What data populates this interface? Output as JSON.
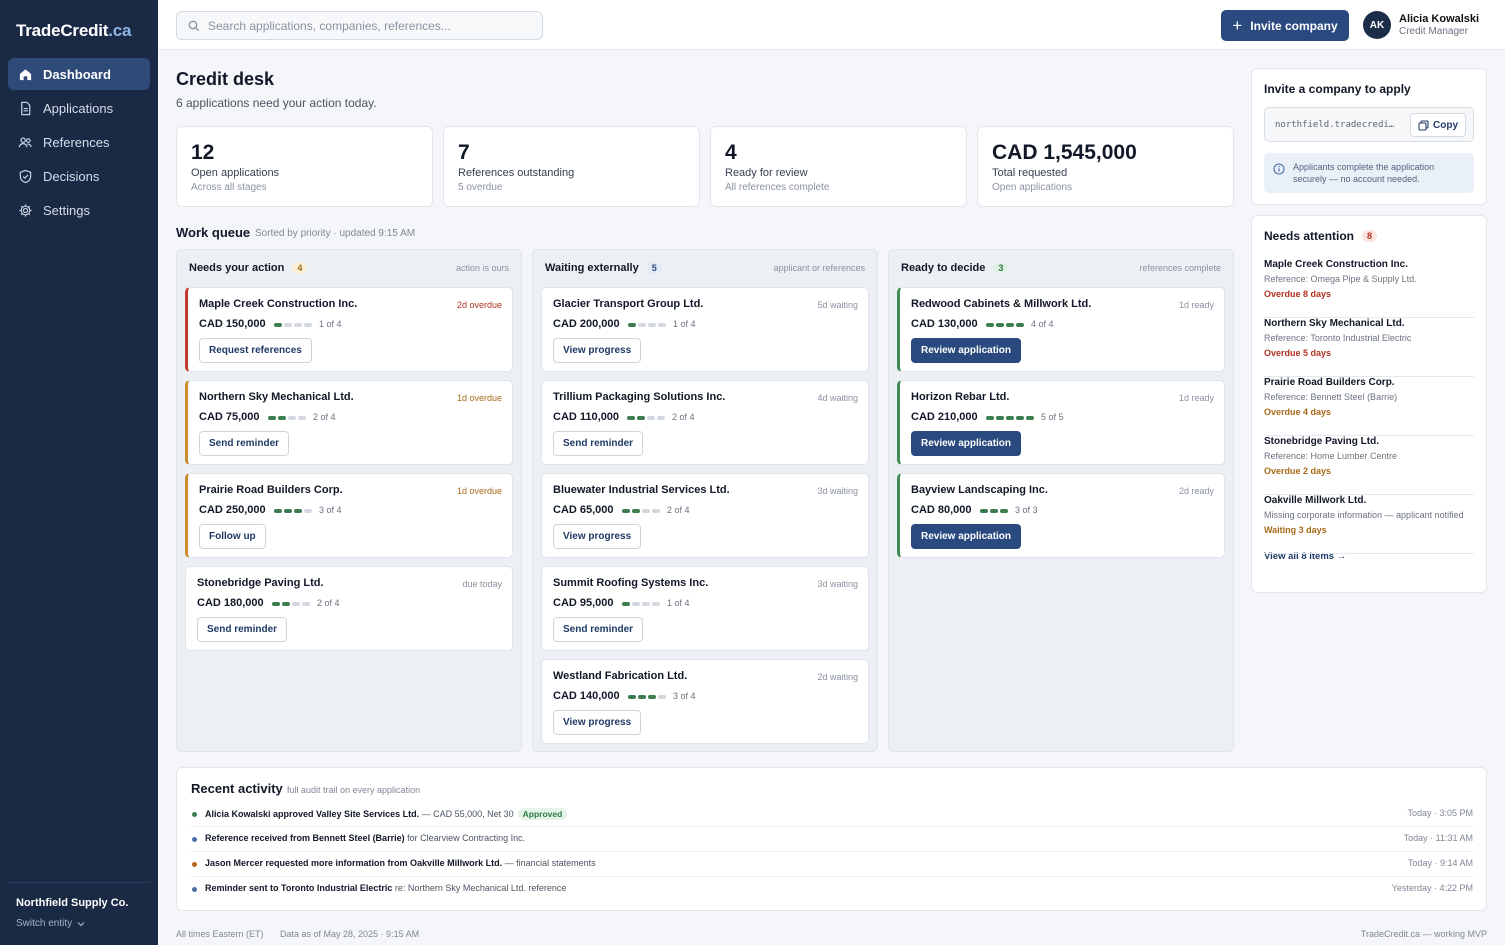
{
  "brand": {
    "name": "TradeCredit",
    "tld": ".ca"
  },
  "sidebar": {
    "items": [
      {
        "label": "Dashboard",
        "icon": "home-icon",
        "active": true
      },
      {
        "label": "Applications",
        "icon": "document-icon"
      },
      {
        "label": "References",
        "icon": "users-icon"
      },
      {
        "label": "Decisions",
        "icon": "shield-check-icon"
      },
      {
        "label": "Settings",
        "icon": "gear-icon"
      }
    ],
    "entity": "Northfield Supply Co.",
    "switch_label": "Switch entity"
  },
  "topbar": {
    "search_placeholder": "Search applications, companies, references...",
    "invite_label": "Invite company",
    "user": {
      "initials": "AK",
      "name": "Alicia Kowalski",
      "role": "Credit Manager"
    }
  },
  "header": {
    "title": "Credit desk",
    "subtitle": "6 applications need your action today."
  },
  "stats": [
    {
      "value": "12",
      "label": "Open applications",
      "sub": "Across all stages"
    },
    {
      "value": "7",
      "label": "References outstanding",
      "sub": "5 overdue"
    },
    {
      "value": "4",
      "label": "Ready for review",
      "sub": "All references complete"
    },
    {
      "value": "CAD 1,545,000",
      "label": "Total requested",
      "sub": "Open applications"
    }
  ],
  "queue": {
    "title": "Work queue",
    "meta": "Sorted by priority · updated 9:15 AM",
    "columns": [
      {
        "title": "Needs your action",
        "count": "4",
        "meta": "action is ours",
        "cards": [
          {
            "name": "Maple Creek Construction Inc.",
            "status": "2d overdue",
            "amount": "CAD 150,000",
            "progress": "1 of 4",
            "done": 1,
            "total": 4,
            "action": "Request references"
          },
          {
            "name": "Northern Sky Mechanical Ltd.",
            "status": "1d overdue",
            "amount": "CAD 75,000",
            "progress": "2 of 4",
            "done": 2,
            "total": 4,
            "action": "Send reminder"
          },
          {
            "name": "Prairie Road Builders Corp.",
            "status": "1d overdue",
            "amount": "CAD 250,000",
            "progress": "3 of 4",
            "done": 3,
            "total": 4,
            "action": "Follow up"
          },
          {
            "name": "Stonebridge Paving Ltd.",
            "status": "due today",
            "amount": "CAD 180,000",
            "progress": "2 of 4",
            "done": 2,
            "total": 4,
            "action": "Send reminder"
          }
        ]
      },
      {
        "title": "Waiting externally",
        "count": "5",
        "meta": "applicant or references",
        "cards": [
          {
            "name": "Glacier Transport Group Ltd.",
            "status": "5d waiting",
            "amount": "CAD 200,000",
            "progress": "1 of 4",
            "done": 1,
            "total": 4,
            "action": "View progress"
          },
          {
            "name": "Trillium Packaging Solutions Inc.",
            "status": "4d waiting",
            "amount": "CAD 110,000",
            "progress": "2 of 4",
            "done": 2,
            "total": 4,
            "action": "Send reminder"
          },
          {
            "name": "Bluewater Industrial Services Ltd.",
            "status": "3d waiting",
            "amount": "CAD 65,000",
            "progress": "2 of 4",
            "done": 2,
            "total": 4,
            "action": "View progress"
          },
          {
            "name": "Summit Roofing Systems Inc.",
            "status": "3d waiting",
            "amount": "CAD 95,000",
            "progress": "1 of 4",
            "done": 1,
            "total": 4,
            "action": "Send reminder"
          },
          {
            "name": "Westland Fabrication Ltd.",
            "status": "2d waiting",
            "amount": "CAD 140,000",
            "progress": "3 of 4",
            "done": 3,
            "total": 4,
            "action": "View progress"
          }
        ]
      },
      {
        "title": "Ready to decide",
        "count": "3",
        "meta": "references complete",
        "cards": [
          {
            "name": "Redwood Cabinets & Millwork Ltd.",
            "status": "1d ready",
            "amount": "CAD 130,000",
            "progress": "4 of 4",
            "done": 4,
            "total": 4,
            "action": "Review application"
          },
          {
            "name": "Horizon Rebar Ltd.",
            "status": "1d ready",
            "amount": "CAD 210,000",
            "progress": "5 of 5",
            "done": 5,
            "total": 5,
            "action": "Review application"
          },
          {
            "name": "Bayview Landscaping Inc.",
            "status": "2d ready",
            "amount": "CAD 80,000",
            "progress": "3 of 3",
            "done": 3,
            "total": 3,
            "action": "Review application"
          }
        ]
      }
    ]
  },
  "invite_panel": {
    "title": "Invite a company to apply",
    "link": "northfield.tradecredit.ca/apply",
    "copy_label": "Copy",
    "info": "Applicants complete the application securely — no account needed."
  },
  "attention": {
    "title": "Needs attention",
    "count": "8",
    "items": [
      {
        "name": "Maple Creek Construction Inc.",
        "ref": "Reference: Omega Pipe & Supply Ltd.",
        "status": "Overdue 8 days",
        "tone": "red"
      },
      {
        "name": "Northern Sky Mechanical Ltd.",
        "ref": "Reference: Toronto Industrial Electric",
        "status": "Overdue 5 days",
        "tone": "red"
      },
      {
        "name": "Prairie Road Builders Corp.",
        "ref": "Reference: Bennett Steel (Barrie)",
        "status": "Overdue 4 days",
        "tone": "amber"
      },
      {
        "name": "Stonebridge Paving Ltd.",
        "ref": "Reference: Home Lumber Centre",
        "status": "Overdue 2 days",
        "tone": "amber"
      },
      {
        "name": "Oakville Millwork Ltd.",
        "ref": "Missing corporate information — applicant notified",
        "status": "Waiting 3 days",
        "tone": "amber"
      }
    ],
    "view_all": "View all 8 items →"
  },
  "activity": {
    "title": "Recent activity",
    "meta": "full audit trail on every application",
    "rows": [
      {
        "bold": "Alicia Kowalski approved Valley Site Services Ltd.",
        "rest": " — CAD 55,000, Net 30",
        "badge": "Approved",
        "time": "Today · 3:05 PM",
        "color": "#3b7d4e"
      },
      {
        "bold": "Reference received from Bennett Steel (Barrie)",
        "rest": " for Clearview Contracting Inc.",
        "badge": "",
        "time": "Today · 11:31 AM",
        "color": "#4a6fa5"
      },
      {
        "bold": "Jason Mercer requested more information from Oakville Millwork Ltd.",
        "rest": " — financial statements",
        "badge": "",
        "time": "Today · 9:14 AM",
        "color": "#b5651d"
      },
      {
        "bold": "Reminder sent to Toronto Industrial Electric",
        "rest": " re: Northern Sky Mechanical Ltd. reference",
        "badge": "",
        "time": "Yesterday · 4:22 PM",
        "color": "#4a6fa5"
      }
    ]
  },
  "footer": {
    "tz": "All times Eastern (ET)",
    "asof": "Data as of May 28, 2025 · 9:15 AM",
    "right": "TradeCredit.ca — working MVP"
  },
  "colors": {
    "sidebar": "#1a2a45",
    "accent": "#2a4a7f",
    "overdue": "#b0331f",
    "warning": "#a86a1a",
    "success": "#3b7d4e"
  }
}
